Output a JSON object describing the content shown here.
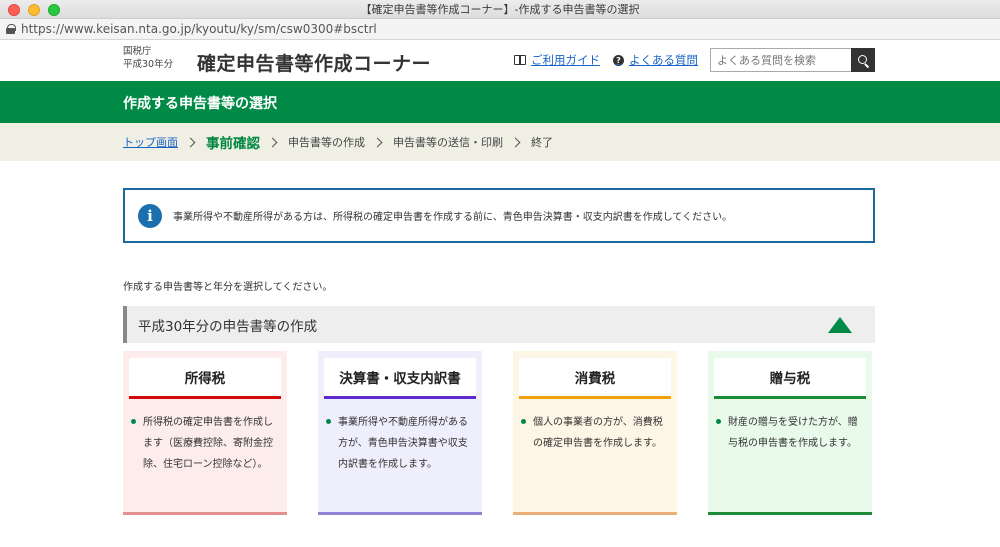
{
  "browser": {
    "window_title": "【確定申告書等作成コーナー】-作成する申告書等の選択",
    "url_prefix": "https://www.keisan.nta.go.jp/",
    "url_path": "kyoutu/ky/sm/csw0300#bsctrl"
  },
  "header": {
    "agency": "国税庁",
    "year_label": "平成30年分",
    "site_title": "確定申告書等作成コーナー",
    "guide_link": "ご利用ガイド",
    "faq_link": "よくある質問",
    "search_placeholder": "よくある質問を検索",
    "icons": {
      "guide": "book-icon",
      "faq": "question-icon",
      "search": "search-icon"
    }
  },
  "page_heading": "作成する申告書等の選択",
  "breadcrumb": {
    "items": [
      "トップ画面",
      "事前確認",
      "申告書等の作成",
      "申告書等の送信・印刷",
      "終了"
    ],
    "current_index": 1
  },
  "info_message": "事業所得や不動産所得がある方は、所得税の確定申告書を作成する前に、青色申告決算書・収支内訳書を作成してください。",
  "instruction": "作成する申告書等と年分を選択してください。",
  "section": {
    "title": "平成30年分の申告書等の作成",
    "cards": [
      {
        "title": "所得税",
        "description": "所得税の確定申告書を作成します（医療費控除、寄附金控除、住宅ローン控除など）。"
      },
      {
        "title": "決算書・収支内訳書",
        "description": "事業所得や不動産所得がある方が、青色申告決算書や収支内訳書を作成します。"
      },
      {
        "title": "消費税",
        "description": "個人の事業者の方が、消費税の確定申告書を作成します。"
      },
      {
        "title": "贈与税",
        "description": "財産の贈与を受けた方が、贈与税の申告書を作成します。"
      }
    ]
  },
  "colors": {
    "brand_green": "#008a46",
    "income_accent": "#d20a0a",
    "statement_accent": "#5b2bcf",
    "consumption_accent": "#efa20a",
    "gift_accent": "#1b8b35",
    "info_border": "#1b6a9e"
  }
}
